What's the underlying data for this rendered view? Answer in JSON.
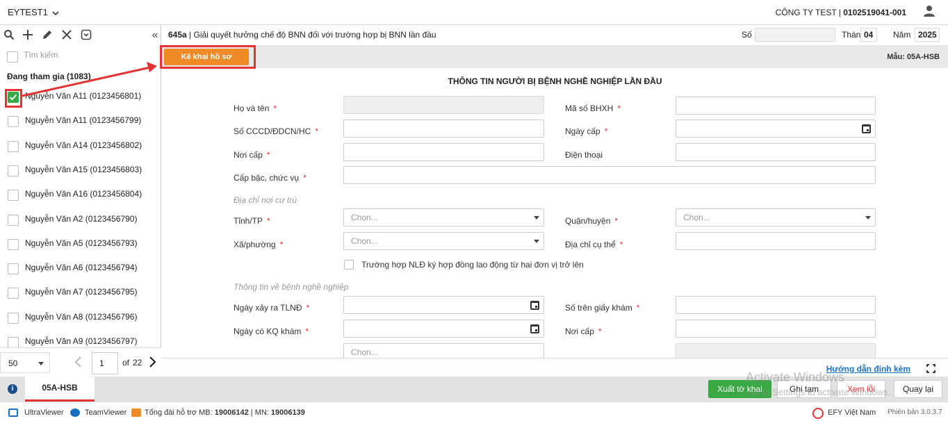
{
  "topbar": {
    "app_name": "EYTEST1",
    "company_name": "CÔNG TY TEST | ",
    "company_code": "0102519041-001"
  },
  "sidebar": {
    "search_placeholder": "Tìm kiếm",
    "group_label": "Đang tham gia (1083)",
    "employees": [
      {
        "label": "Nguyễn Văn A11 (0123456801)",
        "checked": true
      },
      {
        "label": "Nguyễn Văn A11 (0123456799)",
        "checked": false
      },
      {
        "label": "Nguyễn Văn A14 (0123456802)",
        "checked": false
      },
      {
        "label": "Nguyễn Văn A15 (0123456803)",
        "checked": false
      },
      {
        "label": "Nguyễn Văn A16 (0123456804)",
        "checked": false
      },
      {
        "label": "Nguyễn Văn A2 (0123456790)",
        "checked": false
      },
      {
        "label": "Nguyễn Văn A5 (0123456793)",
        "checked": false
      },
      {
        "label": "Nguyễn Văn A6 (0123456794)",
        "checked": false
      },
      {
        "label": "Nguyễn Văn A7 (0123456795)",
        "checked": false
      },
      {
        "label": "Nguyễn Văn A8 (0123456796)",
        "checked": false
      },
      {
        "label": "Nguyễn Văn A9 (0123456797)",
        "checked": false
      }
    ],
    "pager": {
      "page_size": "50",
      "page": "1",
      "of_label": "of",
      "total_pages": "22"
    }
  },
  "header": {
    "form_code": "645a",
    "form_title": " | Giải quyết hưởng chế độ BNN đối với trường hợp bị BNN lần đầu",
    "so_label": "Số",
    "thang_label": "Tháng",
    "thang_value": "04",
    "nam_label": "Năm",
    "nam_value": "2025"
  },
  "toolbar": {
    "kekhai_label": "Kê khai hồ sơ",
    "mau_label": "Mẫu: 05A-HSB"
  },
  "form": {
    "heading": "THÔNG TIN NGƯỜI BỊ BỆNH NGHỀ NGHIỆP LẦN ĐẦU",
    "ho_ten": "Họ và tên",
    "ma_so_bhxh": "Mã số BHXH",
    "so_cccd": "Số CCCD/ĐDCN/HC",
    "ngay_cap": "Ngày cấp",
    "noi_cap": "Nơi cấp",
    "dien_thoai": "Điện thoại",
    "cap_bac": "Cấp bậc, chức vụ",
    "section_address": "Địa chỉ nơi cư trú",
    "tinh_tp": "Tỉnh/TP",
    "quan_huyen": "Quận/huyện",
    "xa_phuong": "Xã/phường",
    "dia_chi": "Địa chỉ cụ thể",
    "select_placeholder": "Chọn...",
    "multi_contract": "Trường hợp NLĐ ký hợp đồng lao động từ hai đơn vị trở lên",
    "section_disease": "Thông tin về bệnh nghề nghiệp",
    "ngay_xay_ra": "Ngày xảy ra TLNĐ",
    "so_giay_kham": "Số trên giấy khám",
    "ngay_kq_kham": "Ngày có KQ khám",
    "noi_cap_2": "Nơi cấp",
    "required_mark": "*"
  },
  "footer_link": "Hướng dẫn đính kèm",
  "actionbar": {
    "tab_label": "05A-HSB",
    "xuat_to_khai": "Xuất tờ khai",
    "ghi_tam": "Ghi tạm",
    "xem_loi": "Xem lỗi",
    "quay_lai": "Quay lại"
  },
  "watermark": {
    "line1": "Activate Windows",
    "line2": "Go to Settings to activate Windows."
  },
  "statusbar": {
    "ultraviewer": "UltraViewer",
    "teamviewer": "TeamViewer",
    "hotline_prefix": "Tổng đài hỗ trợ MB: ",
    "hotline_mb": "19006142",
    "hotline_mid": " | MN: ",
    "hotline_mn": "19006139",
    "efy": "EFY Việt Nam",
    "version": "Phiên bản 3.0.3.7"
  },
  "colors": {
    "accent_orange": "#ee8a28",
    "highlight_red": "#e53232",
    "primary_green": "#3aa845",
    "link_blue": "#1a73c8"
  }
}
